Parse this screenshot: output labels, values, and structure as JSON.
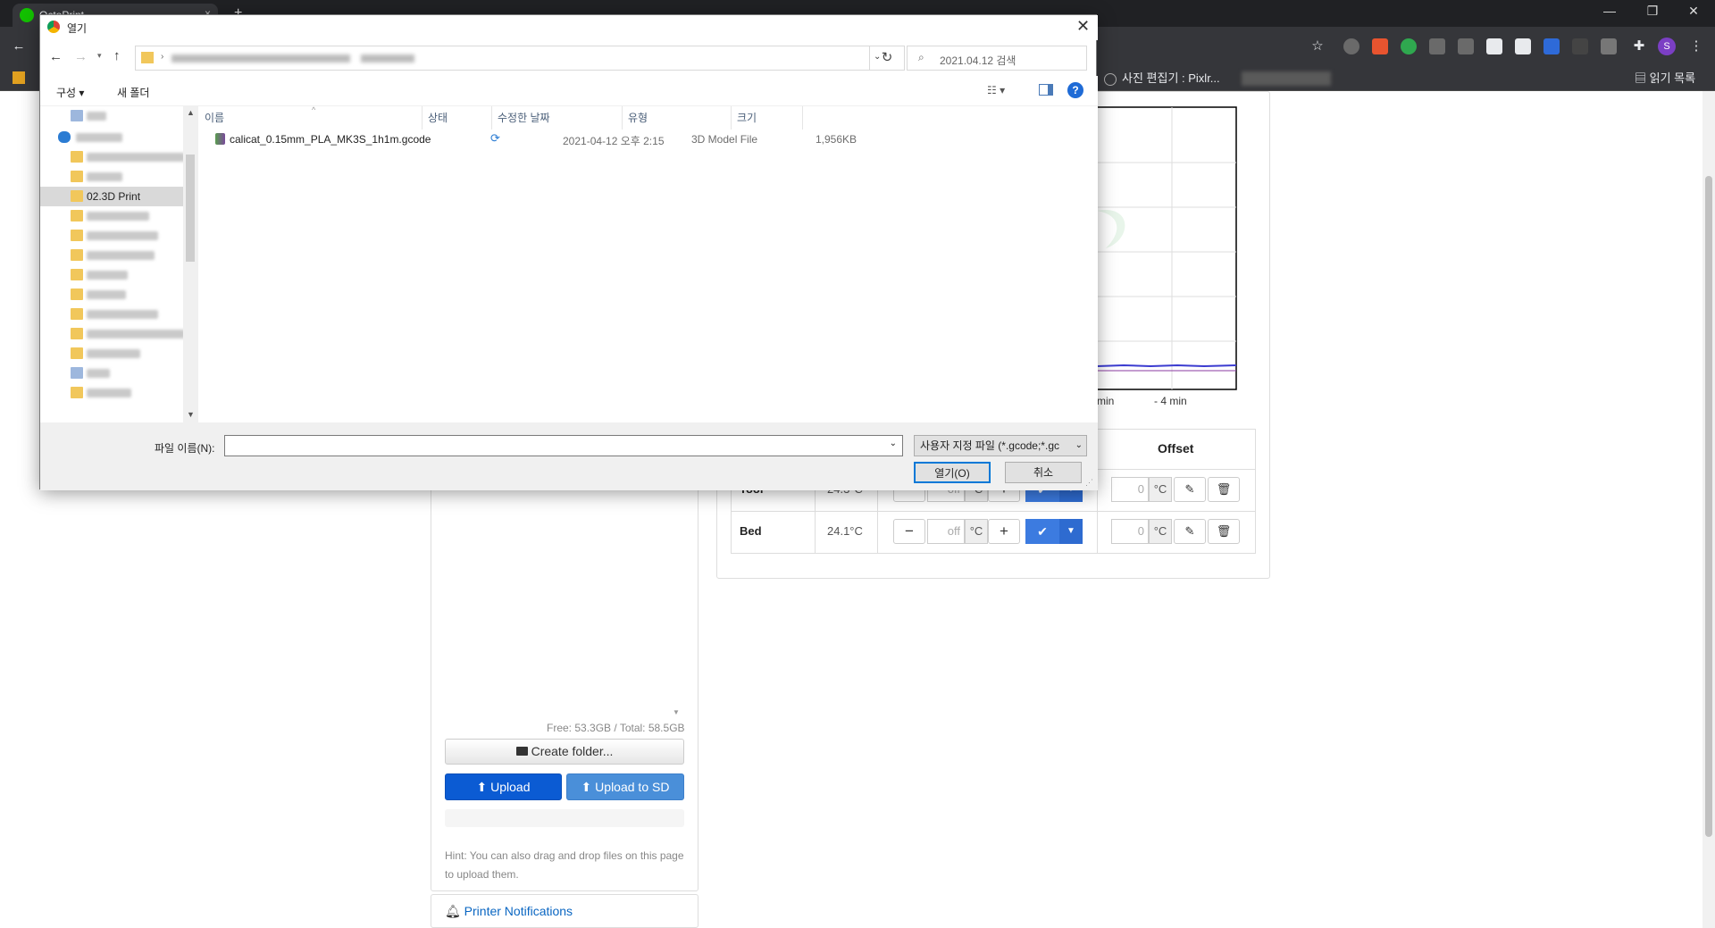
{
  "browser": {
    "tab_title": "OctoPrint",
    "tab_close": "×",
    "win_minimize": "—",
    "win_restore": "❐",
    "win_close": "✕",
    "bookmarks": [
      {
        "label": "사진 편집기 : Pixlr..."
      }
    ],
    "reading_list": "읽기 목록",
    "profile_initial": "S"
  },
  "page": {
    "chart": {
      "x_ticks": [
        "min",
        "- 4 min"
      ]
    },
    "temp_table": {
      "offset_header": "Offset",
      "rows": [
        {
          "name": "Tool",
          "actual": "24.3°C",
          "target": "off",
          "unit": "°C",
          "offset": "0",
          "offset_unit": "°C"
        },
        {
          "name": "Bed",
          "actual": "24.1°C",
          "target": "off",
          "unit": "°C",
          "offset": "0",
          "offset_unit": "°C"
        }
      ]
    },
    "files": {
      "free_space": "Free: 53.3GB / Total: 58.5GB",
      "create_folder": "Create folder...",
      "upload": "Upload",
      "upload_sd": "Upload to SD",
      "hint": "Hint: You can also drag and drop files on this page to upload them."
    },
    "notifications": "Printer Notifications"
  },
  "dialog": {
    "title": "열기",
    "search_placeholder": "2021.04.12 검색",
    "organize": "구성 ▾",
    "new_folder": "새 폴더",
    "help": "?",
    "nav_selected": "02.3D Print",
    "columns": {
      "name": "이름",
      "status": "상태",
      "modified": "수정한 날짜",
      "type": "유형",
      "size": "크기"
    },
    "files": [
      {
        "name": "calicat_0.15mm_PLA_MK3S_1h1m.gcode",
        "modified": "2021-04-12 오후 2:15",
        "type": "3D Model File",
        "size": "1,956KB"
      }
    ],
    "filename_label": "파일 이름(N):",
    "filename_value": "",
    "filter": "사용자 지정 파일 (*.gcode;*.gc",
    "open_button": "열기(O)",
    "cancel_button": "취소"
  }
}
